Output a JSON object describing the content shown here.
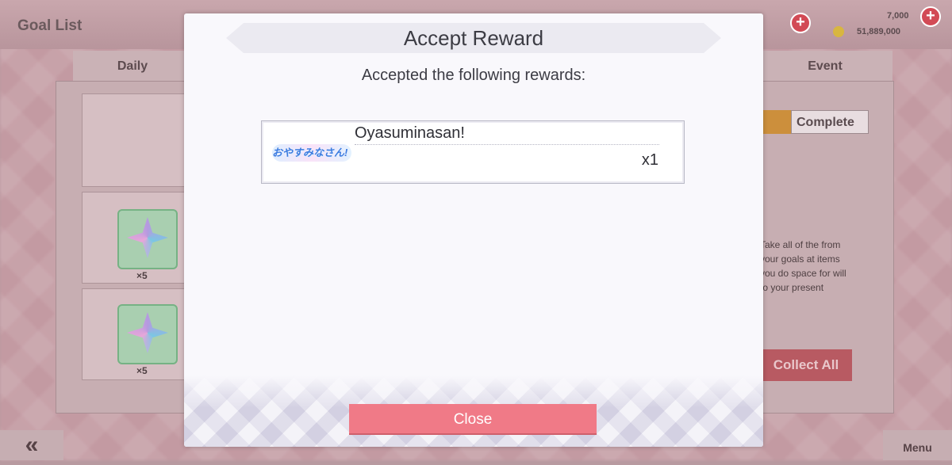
{
  "background": {
    "title": "Goal List",
    "tabs": [
      "Daily",
      "Event"
    ],
    "filter_label": "Complete",
    "currency_top": "7,000",
    "currency_bottom": "51,889,000",
    "item_qty": "×5",
    "help_text": "Take all of the from your goals at items you do space for will to your present",
    "collect_all_label": "Collect All",
    "back_label": "«",
    "menu_label": "Menu"
  },
  "modal": {
    "title": "Accept Reward",
    "subtitle": "Accepted the following rewards:",
    "reward": {
      "logo_text": "おやすみなさん!",
      "name": "Oyasuminasan!",
      "quantity": "x1"
    },
    "close_label": "Close"
  },
  "colors": {
    "close_button": "#f07a87",
    "modal_bg": "#f9f8fc",
    "dim_bg": "#c39aa2"
  }
}
